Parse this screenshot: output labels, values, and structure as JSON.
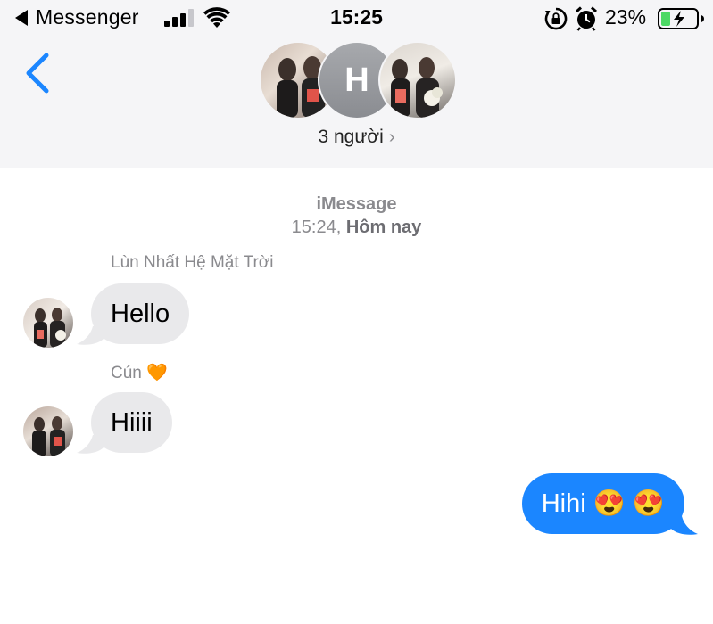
{
  "status_bar": {
    "back_app": "Messenger",
    "time": "15:25",
    "battery_percent": "23%"
  },
  "header": {
    "avatar_letter": "H",
    "participants": "3 người"
  },
  "conversation": {
    "service": "iMessage",
    "timestamp_time": "15:24, ",
    "timestamp_day": "Hôm nay",
    "messages": [
      {
        "sender": "Lùn Nhất Hệ Mặt Trời",
        "text": "Hello",
        "direction": "incoming"
      },
      {
        "sender": "Cún 🧡",
        "text": "Hiiii",
        "direction": "incoming"
      },
      {
        "text": "Hihi 😍 😍",
        "direction": "outgoing"
      }
    ]
  },
  "colors": {
    "accent": "#1b86ff",
    "incoming_bubble": "#e9e9eb",
    "header_bg": "#f5f5f7",
    "meta_text": "#8a8a8e",
    "battery_fill": "#4cd964"
  }
}
